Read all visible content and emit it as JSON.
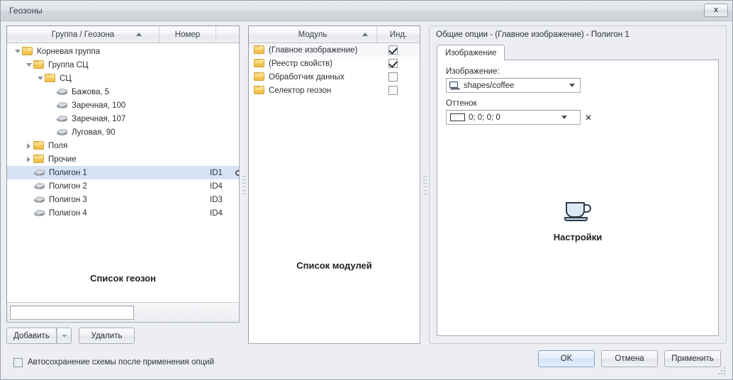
{
  "window": {
    "title": "Геозоны",
    "close_label": "x"
  },
  "geozone_list": {
    "columns": [
      {
        "label": "Группа / Геозона",
        "sorted": "asc"
      },
      {
        "label": "Номер",
        "sorted": ""
      },
      {
        "label": "",
        "sorted": ""
      }
    ],
    "rows": [
      {
        "label": "Корневая группа",
        "icon": "folder-icon",
        "indent": 0,
        "expander": "open",
        "id": "",
        "gear": false,
        "selected": false
      },
      {
        "label": "Группа СЦ",
        "icon": "folder-icon",
        "indent": 1,
        "expander": "open",
        "id": "",
        "gear": false,
        "selected": false
      },
      {
        "label": "СЦ",
        "icon": "folder-icon",
        "indent": 2,
        "expander": "open",
        "id": "",
        "gear": false,
        "selected": false
      },
      {
        "label": "Бажова, 5",
        "icon": "geozone-icon",
        "indent": 3,
        "expander": "blank",
        "id": "",
        "gear": false,
        "selected": false
      },
      {
        "label": "Заречная, 100",
        "icon": "geozone-icon",
        "indent": 3,
        "expander": "blank",
        "id": "",
        "gear": false,
        "selected": false
      },
      {
        "label": "Заречная, 107",
        "icon": "geozone-icon",
        "indent": 3,
        "expander": "blank",
        "id": "",
        "gear": false,
        "selected": false
      },
      {
        "label": "Луговая, 90",
        "icon": "geozone-icon",
        "indent": 3,
        "expander": "blank",
        "id": "",
        "gear": false,
        "selected": false
      },
      {
        "label": "Поля",
        "icon": "folder-icon",
        "indent": 1,
        "expander": "closed",
        "id": "",
        "gear": false,
        "selected": false
      },
      {
        "label": "Прочие",
        "icon": "folder-icon",
        "indent": 1,
        "expander": "closed",
        "id": "",
        "gear": false,
        "selected": false
      },
      {
        "label": "Полигон 1",
        "icon": "geozone-icon",
        "indent": 1,
        "expander": "blank",
        "id": "ID1",
        "gear": true,
        "selected": true
      },
      {
        "label": "Полигон 2",
        "icon": "geozone-icon",
        "indent": 1,
        "expander": "blank",
        "id": "ID4",
        "gear": false,
        "selected": false
      },
      {
        "label": "Полигон 3",
        "icon": "geozone-icon",
        "indent": 1,
        "expander": "blank",
        "id": "ID3",
        "gear": false,
        "selected": false
      },
      {
        "label": "Полигон 4",
        "icon": "geozone-icon",
        "indent": 1,
        "expander": "blank",
        "id": "ID4",
        "gear": false,
        "selected": false
      }
    ],
    "caption": "Список геозон",
    "search": {
      "value": "",
      "placeholder": ""
    },
    "buttons": {
      "add": "Добавить",
      "add_dropdown": "▾",
      "delete": "Удалить"
    }
  },
  "module_list": {
    "columns": [
      {
        "label": "Модуль",
        "sorted": "asc"
      },
      {
        "label": "Инд.",
        "sorted": ""
      }
    ],
    "rows": [
      {
        "label": "(Главное изображение)",
        "icon": "folder-icon",
        "checked": true,
        "selected": true
      },
      {
        "label": "(Реестр свойств)",
        "icon": "folder-icon",
        "checked": true,
        "selected": false
      },
      {
        "label": "Обработчик данных",
        "icon": "folder-icon",
        "checked": false,
        "selected": false
      },
      {
        "label": "Селектор геозон",
        "icon": "folder-icon",
        "checked": false,
        "selected": false
      }
    ],
    "caption": "Список модулей"
  },
  "options_panel": {
    "title": "Общие опции - (Главное изображение) - Полигон 1",
    "tabs": [
      {
        "label": "Изображение",
        "active": true
      }
    ],
    "fields": [
      {
        "label": "Изображение:",
        "value": "shapes/coffee",
        "icon": "monitor-icon",
        "has_clear": false
      },
      {
        "label": "Оттенок",
        "value": "0; 0; 0; 0",
        "icon": "color-swatch-icon",
        "has_clear": true,
        "clear_label": "✕",
        "swatch_color": "#ffffff"
      }
    ],
    "caption": "Настройки",
    "caption_icon": "coffee-cup-icon"
  },
  "footer": {
    "autosave": {
      "label": "Автосохранение схемы после применения опций",
      "checked": false
    },
    "buttons": {
      "ok": "OK",
      "cancel": "Отмена",
      "apply": "Применить"
    }
  },
  "colors": {
    "selection": "#d6e3f5",
    "folder": "#f6c95b",
    "window_bg": "#eceef1",
    "accent_button_border": "#7ea3cf"
  }
}
